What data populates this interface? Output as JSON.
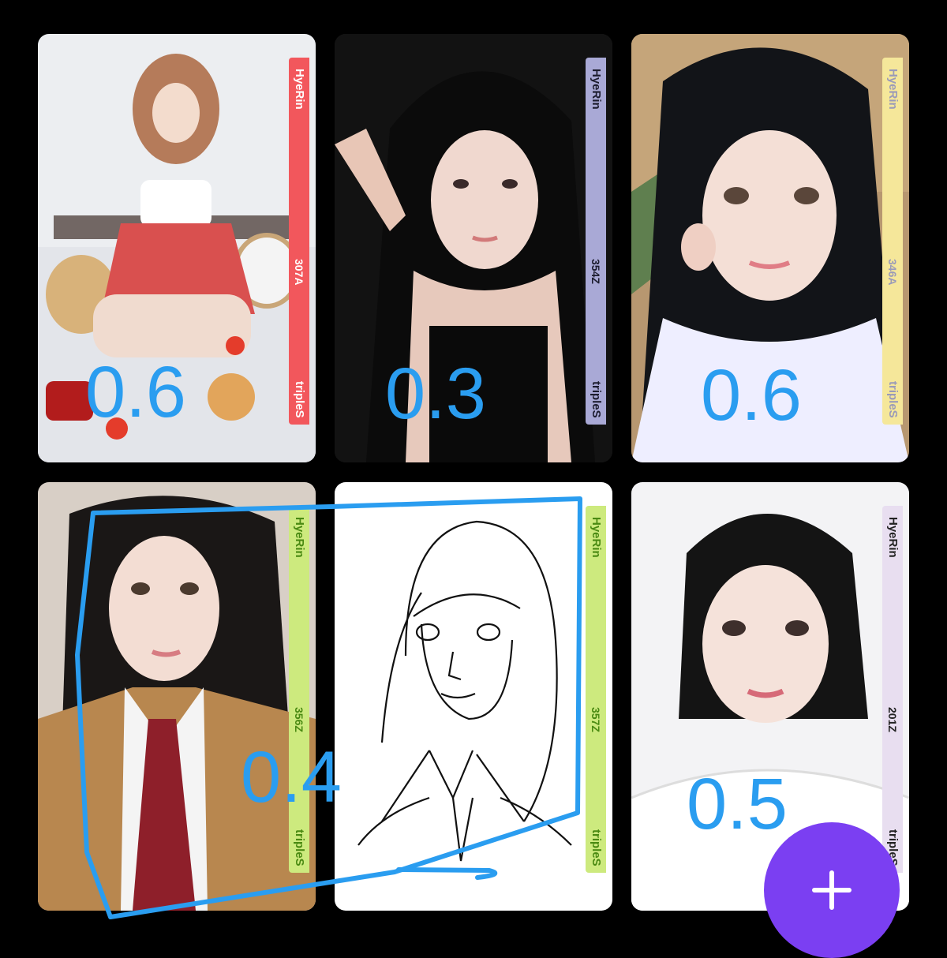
{
  "cards": [
    {
      "member": "HyeRin",
      "serial": "307A",
      "group": "tripleS",
      "strip_color": "#f2575c",
      "text_color": "#ffffff",
      "photo_desc": "girl-seated-picnic"
    },
    {
      "member": "HyeRin",
      "serial": "354Z",
      "group": "tripleS",
      "strip_color": "#a9a9d6",
      "text_color": "#1c1c2e",
      "photo_desc": "girl-peace-sign-dark"
    },
    {
      "member": "HyeRin",
      "serial": "346A",
      "group": "tripleS",
      "strip_color": "#f5e79a",
      "text_color": "#9a9ab8",
      "photo_desc": "girl-selfie-white-shirt"
    },
    {
      "member": "HyeRin",
      "serial": "356Z",
      "group": "tripleS",
      "strip_color": "#cdea7e",
      "text_color": "#4a8a12",
      "photo_desc": "girl-school-uniform"
    },
    {
      "member": "HyeRin",
      "serial": "357Z",
      "group": "tripleS",
      "strip_color": "#cdea7e",
      "text_color": "#4a8a12",
      "photo_desc": "line-drawing-portrait"
    },
    {
      "member": "HyeRin",
      "serial": "201Z",
      "group": "tripleS",
      "strip_color": "#e8def0",
      "text_color": "#222222",
      "photo_desc": "girl-white-shirt-hair-up"
    }
  ],
  "annotations": {
    "color": "#2a9df0",
    "prices": [
      "0.6",
      "0.3",
      "0.6",
      "0.4",
      "0.5"
    ]
  },
  "fab": {
    "icon": "plus-icon",
    "color": "#7b3ff2"
  }
}
